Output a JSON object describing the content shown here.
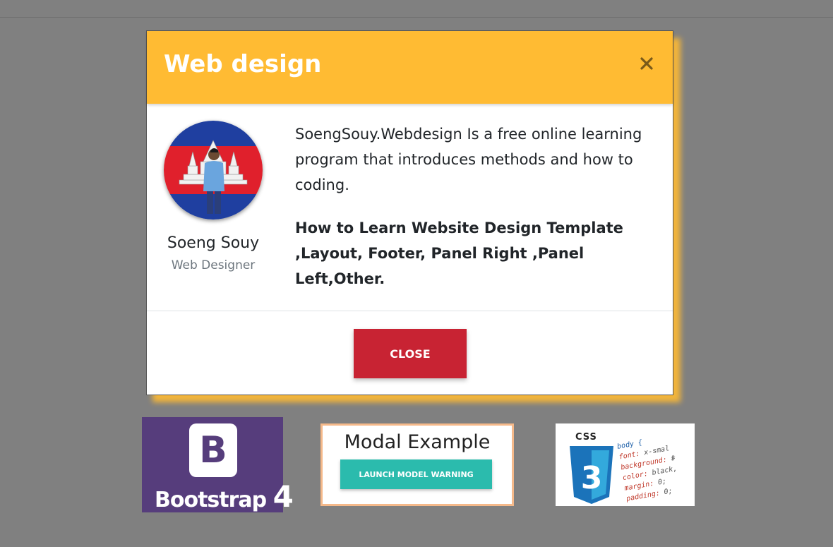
{
  "modal": {
    "title": "Web design",
    "close_icon": "close-icon",
    "profile": {
      "name": "Soeng Souy",
      "role": "Web Designer",
      "avatar_icon": "cambodia-flag-avatar"
    },
    "description": "SoengSouy.Webdesign Is a free online learning program that introduces methods and how to coding.",
    "highlight": "How to Learn Website Design Template ,Layout, Footer, Panel Right ,Panel Left,Other.",
    "close_label": "CLOSE"
  },
  "thumbnails": {
    "bootstrap": {
      "logo_letter": "B",
      "label_word": "Bootstrap",
      "label_number": "4"
    },
    "modal_example": {
      "title": "Modal Example",
      "button_label": "LAUNCH MODEL WARNING"
    },
    "css": {
      "word": "CSS",
      "badge_number": "3",
      "code_selector": "body {",
      "code_lines": [
        {
          "prop": "font:",
          "val": "x-smal"
        },
        {
          "prop": "background:",
          "val": "#"
        },
        {
          "prop": "color:",
          "val": "black,"
        },
        {
          "prop": "margin:",
          "val": "0;"
        },
        {
          "prop": "padding:",
          "val": "0;"
        }
      ]
    }
  },
  "colors": {
    "backdrop": "#808080",
    "header": "#ffbb33",
    "danger": "#c82333",
    "bootstrap_purple": "#563d7c",
    "teal": "#2bbbad"
  }
}
